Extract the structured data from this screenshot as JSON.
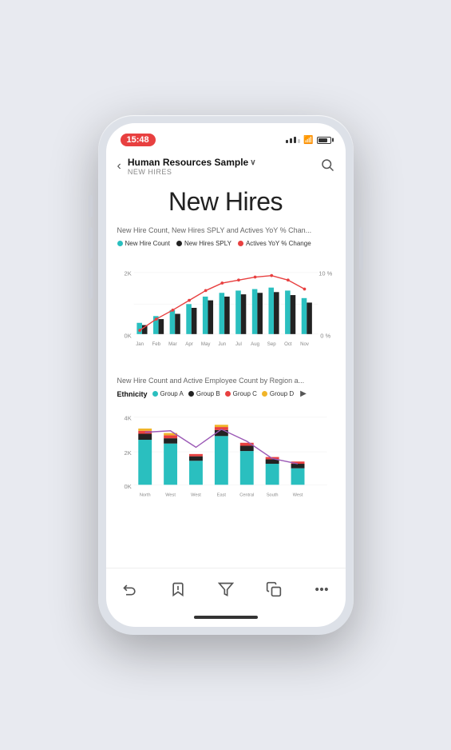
{
  "status": {
    "time": "15:48"
  },
  "nav": {
    "back_label": "‹",
    "title": "Human Resources Sample",
    "title_chevron": "∨",
    "subtitle": "NEW HIRES",
    "search_label": "⌕"
  },
  "page": {
    "title": "New Hires"
  },
  "chart1": {
    "title": "New Hire Count, New Hires SPLY and Actives YoY % Chan...",
    "legend": [
      {
        "label": "New Hire Count",
        "color": "#2abfbf"
      },
      {
        "label": "New Hires SPLY",
        "color": "#222222"
      },
      {
        "label": "Actives YoY % Change",
        "color": "#e84040"
      }
    ],
    "y_labels": [
      "2K",
      "0K"
    ],
    "y_right_labels": [
      "10 %",
      "0 %"
    ],
    "x_labels": [
      "Jan",
      "Feb",
      "Mar",
      "Apr",
      "May",
      "Jun",
      "Jul",
      "Aug",
      "Sep",
      "Oct",
      "Nov"
    ]
  },
  "chart2": {
    "title": "New Hire Count and Active Employee Count by Region a...",
    "ethnicity_label": "Ethnicity",
    "legend": [
      {
        "label": "Group A",
        "color": "#2abfbf"
      },
      {
        "label": "Group B",
        "color": "#222222"
      },
      {
        "label": "Group C",
        "color": "#e84040"
      },
      {
        "label": "Group D",
        "color": "#f0b429"
      }
    ],
    "y_labels": [
      "4K",
      "2K",
      "0K"
    ],
    "x_labels": [
      "North",
      "West",
      "West",
      "East",
      "Central",
      "South",
      "West"
    ]
  },
  "toolbar": {
    "undo_label": "↩",
    "bookmark_label": "🔖",
    "filter_label": "⊟",
    "copy_label": "⧉",
    "more_label": "···"
  }
}
